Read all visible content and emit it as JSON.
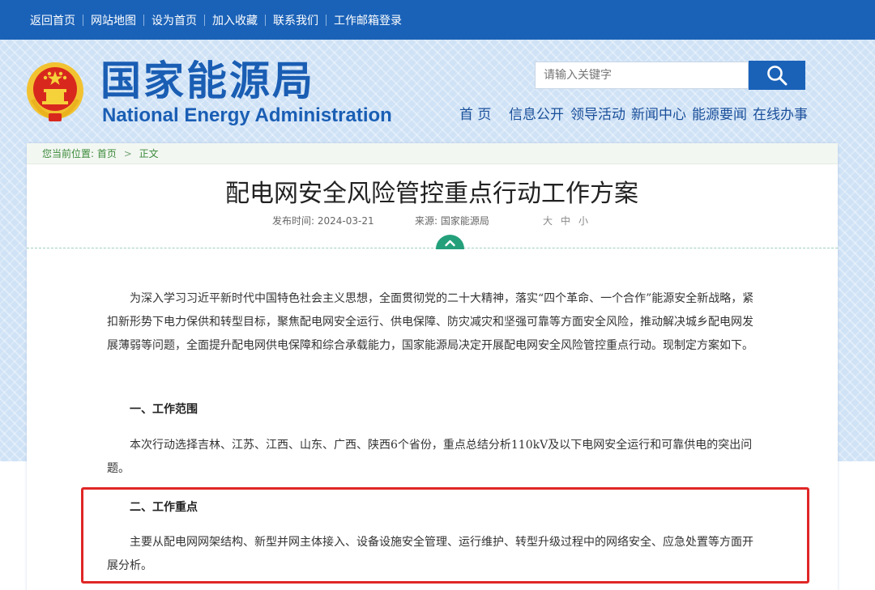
{
  "top_nav": [
    {
      "label": "返回首页"
    },
    {
      "label": "网站地图"
    },
    {
      "label": "设为首页"
    },
    {
      "label": "加入收藏"
    },
    {
      "label": "联系我们"
    },
    {
      "label": "工作邮箱登录"
    }
  ],
  "logo": {
    "chinese": "国家能源局",
    "english": "National Energy Administration",
    "emblem_icon": "national-emblem-icon"
  },
  "search": {
    "placeholder": "请输入关键字",
    "button_icon": "search-icon"
  },
  "main_nav": [
    {
      "label": "首 页"
    },
    {
      "label": "信息公开"
    },
    {
      "label": "领导活动"
    },
    {
      "label": "新闻中心"
    },
    {
      "label": "能源要闻"
    },
    {
      "label": "在线办事"
    }
  ],
  "breadcrumb": {
    "prefix": "您当前位置:",
    "home": "首页",
    "separator": ">",
    "current": "正文"
  },
  "article": {
    "title": "配电网安全风险管控重点行动工作方案",
    "publish_time": "发布时间: 2024-03-21",
    "source": "来源: 国家能源局",
    "font_sizes": [
      "大",
      "中",
      "小"
    ],
    "toggle_icon": "chevron-up-icon",
    "paragraphs": [
      "为深入学习习近平新时代中国特色社会主义思想，全面贯彻党的二十大精神，落实“四个革命、一个合作”能源安全新战略，紧扣新形势下电力保供和转型目标，聚焦配电网安全运行、供电保障、防灾减灾和坚强可靠等方面安全风险，推动解决城乡配电网发展薄弱等问题，全面提升配电网供电保障和综合承载能力，国家能源局决定开展配电网安全风险管控重点行动。现制定方案如下。",
      "本次行动选择吉林、江苏、江西、山东、广西、陕西6个省份，重点总结分析110kV及以下电网安全运行和可靠供电的突出问题。",
      "主要从配电网网架结构、新型并网主体接入、设备设施安全管理、运行维护、转型升级过程中的网络安全、应急处置等方面开展分析。"
    ],
    "headings": [
      "一、工作范围",
      "二、工作重点"
    ]
  },
  "colors": {
    "brand_blue": "#1a62b8",
    "highlight_red": "#e02626",
    "toggle_green": "#23a07a"
  }
}
